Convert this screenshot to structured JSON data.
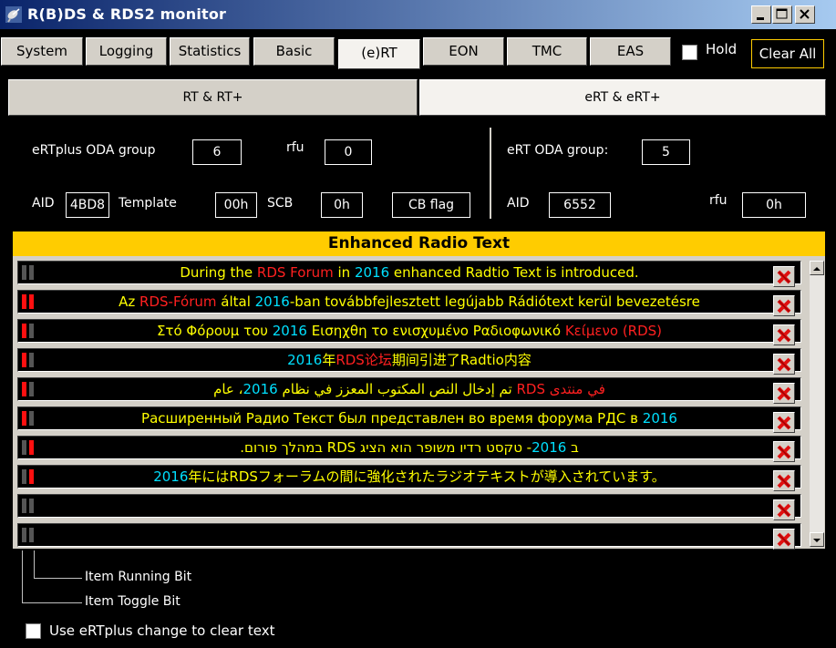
{
  "window": {
    "title": "R(B)DS & RDS2 monitor"
  },
  "tabs": [
    {
      "label": "System"
    },
    {
      "label": "Logging"
    },
    {
      "label": "Statistics"
    },
    {
      "label": "Basic"
    },
    {
      "label": "(e)RT"
    },
    {
      "label": "EON"
    },
    {
      "label": "TMC"
    },
    {
      "label": "EAS"
    }
  ],
  "hold_label": "Hold",
  "clear_all_label": "Clear All",
  "subtabs": [
    {
      "label": "RT & RT+"
    },
    {
      "label": "eRT & eRT+"
    }
  ],
  "ertplus": {
    "oda_group_label": "eRTplus ODA group",
    "oda_group": "6",
    "rfu_label": "rfu",
    "rfu": "0",
    "aid_label": "AID",
    "aid": "4BD8",
    "template_label": "Template",
    "template": "00h",
    "scb_label": "SCB",
    "scb": "0h",
    "cb_flag_label": "CB flag"
  },
  "ert": {
    "oda_group_label": "eRT ODA group:",
    "oda_group": "5",
    "aid_label": "AID",
    "aid": "6552",
    "rfu_label": "rfu",
    "rfu": "0h"
  },
  "panel_title": "Enhanced Radio Text",
  "rows": [
    {
      "running": false,
      "toggle": false,
      "rtl": false,
      "spans": [
        [
          "During the ",
          "y"
        ],
        [
          "RDS Forum",
          "r"
        ],
        [
          " in ",
          "y"
        ],
        [
          "2016",
          "c"
        ],
        [
          " enhanced Radtio Text is introduced.",
          "y"
        ]
      ]
    },
    {
      "running": true,
      "toggle": true,
      "rtl": false,
      "spans": [
        [
          "Az ",
          "y"
        ],
        [
          "RDS-Fórum",
          "r"
        ],
        [
          " által ",
          "y"
        ],
        [
          "2016",
          "c"
        ],
        [
          "-ban továbbfejlesztett legújabb Rádiótext kerül bevezetésre",
          "y"
        ]
      ]
    },
    {
      "running": false,
      "toggle": true,
      "rtl": false,
      "spans": [
        [
          "Στό Φόρουμ του ",
          "y"
        ],
        [
          "2016",
          "c"
        ],
        [
          " Εισηχθη το ενισχυμένο Ραδιοφωνικό ",
          "y"
        ],
        [
          "Κείμενο (RDS)",
          "r"
        ]
      ]
    },
    {
      "running": false,
      "toggle": true,
      "rtl": false,
      "spans": [
        [
          "2016",
          "c"
        ],
        [
          "年",
          "y"
        ],
        [
          "RDS论坛",
          "r"
        ],
        [
          "期间引进了Radtio内容",
          "y"
        ]
      ]
    },
    {
      "running": false,
      "toggle": true,
      "rtl": true,
      "spans": [
        [
          "في منتدى ",
          "r"
        ],
        [
          "RDS",
          "r"
        ],
        [
          " تم إدخال النص المكتوب المعزز في نظام ",
          "y"
        ],
        [
          "2016",
          "c"
        ],
        [
          "، عام",
          "y"
        ]
      ]
    },
    {
      "running": false,
      "toggle": true,
      "rtl": false,
      "spans": [
        [
          "Расширенный Радио Текст был представлен во время форума РДС в ",
          "y"
        ],
        [
          "2016",
          "c"
        ]
      ]
    },
    {
      "running": true,
      "toggle": false,
      "rtl": true,
      "spans": [
        [
          "ב ",
          "y"
        ],
        [
          "2016",
          "c"
        ],
        [
          "- טקסט רדיו משופר הוא הציג RDS במהלך פורום.",
          "y"
        ]
      ]
    },
    {
      "running": true,
      "toggle": false,
      "rtl": false,
      "spans": [
        [
          "2016",
          "c"
        ],
        [
          "年にはRDSフォーラムの間に強化されたラジオテキストが導入されています。",
          "y"
        ]
      ]
    },
    {
      "running": false,
      "toggle": false,
      "rtl": false,
      "spans": []
    },
    {
      "running": false,
      "toggle": false,
      "rtl": false,
      "spans": []
    }
  ],
  "legend": {
    "running": "Item Running Bit",
    "toggle": "Item Toggle Bit"
  },
  "use_change_label": "Use eRTplus change to clear text",
  "colors": {
    "bit_on": "#ff1010",
    "bit_off": "#555555",
    "accent": "#ffcc00"
  }
}
